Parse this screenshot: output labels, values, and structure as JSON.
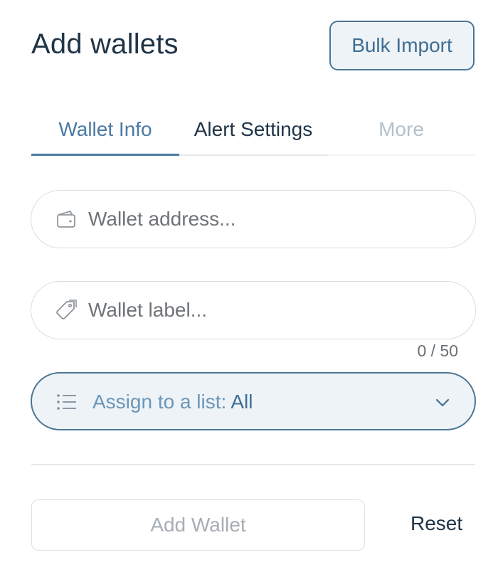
{
  "header": {
    "title": "Add wallets",
    "bulk_import_label": "Bulk Import"
  },
  "tabs": [
    {
      "label": "Wallet Info",
      "active": true
    },
    {
      "label": "Alert Settings",
      "active": false
    },
    {
      "label": "More",
      "active": false
    }
  ],
  "form": {
    "address": {
      "placeholder": "Wallet address...",
      "value": "",
      "icon": "wallet-icon"
    },
    "label": {
      "placeholder": "Wallet label...",
      "value": "",
      "icon": "tag-icon"
    },
    "label_counter": "0 / 50",
    "assign": {
      "label": "Assign to a list:",
      "value": "All",
      "icon": "list-icon"
    }
  },
  "actions": {
    "add_wallet_label": "Add Wallet",
    "reset_label": "Reset"
  },
  "colors": {
    "accent": "#4a7aa3",
    "title": "#1f3447",
    "assign_bg": "#eef3f7"
  }
}
